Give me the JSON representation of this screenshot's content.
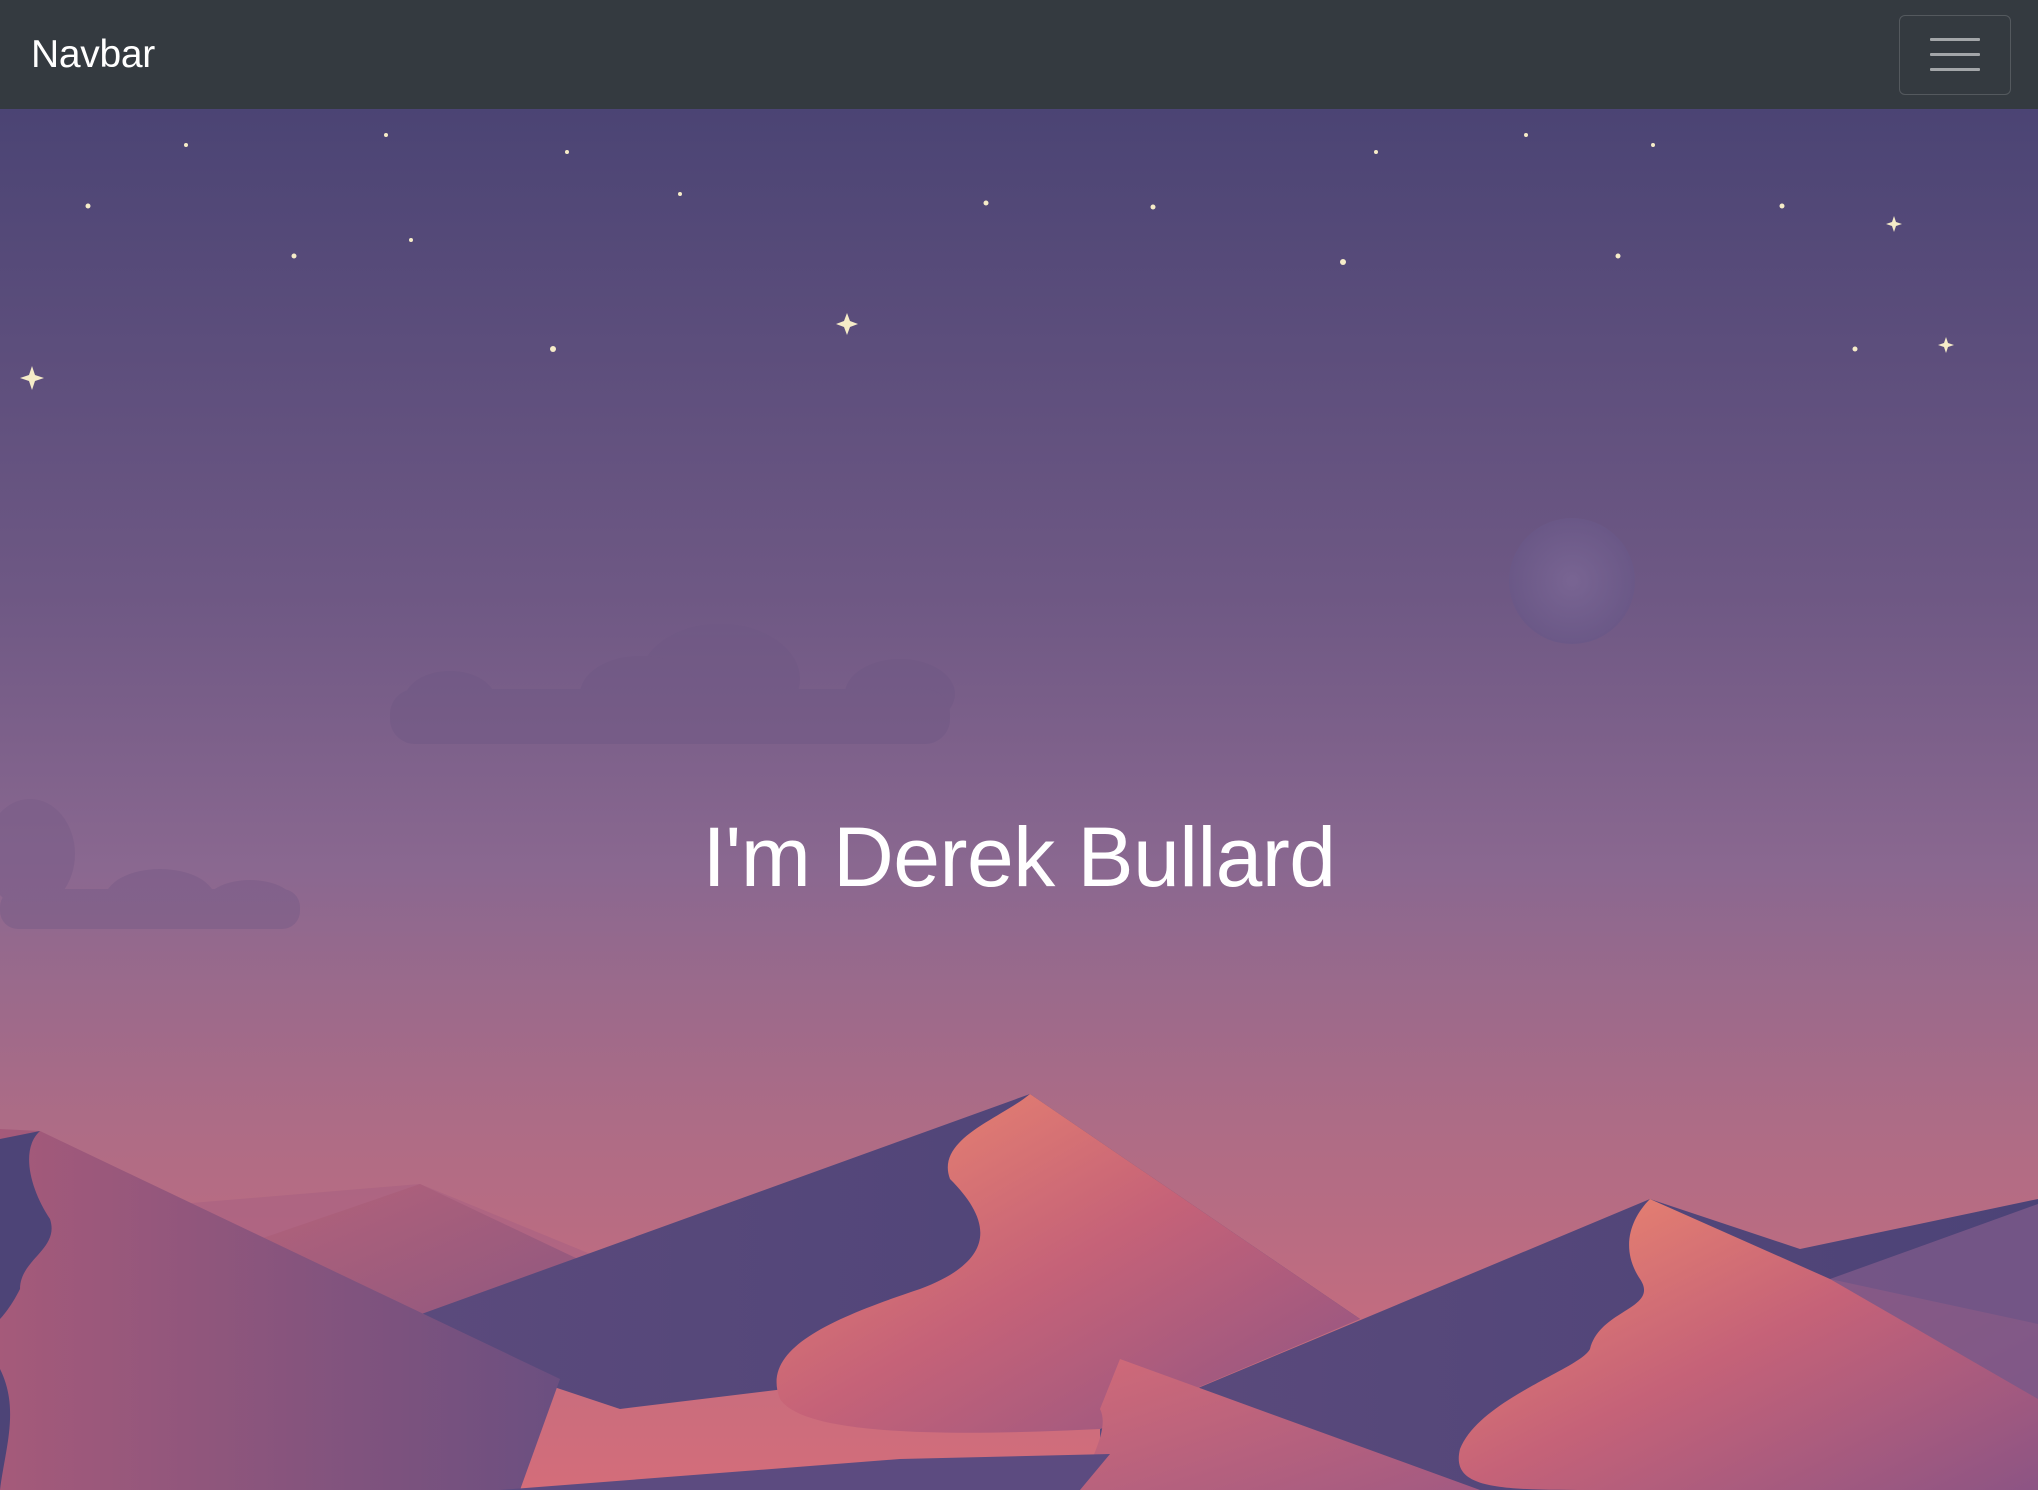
{
  "navbar": {
    "brand": "Navbar",
    "toggler_icon": "hamburger-menu-icon"
  },
  "hero": {
    "headline": "I'm Derek Bullard",
    "illustration": "desert-night-scene",
    "moon_icon": "crescent-moon-icon",
    "star_icon": "sparkle-star-icon"
  },
  "colors": {
    "navbar_bg": "#343a40",
    "sky_top": "#4b4474",
    "sky_mid": "#8a6890",
    "sky_bottom": "#c26c80",
    "dune_dark": "#4e467a",
    "dune_pink": "#c96678",
    "dune_glow": "#f18a70",
    "moon": "#f0e0b8",
    "text": "#ffffff"
  }
}
